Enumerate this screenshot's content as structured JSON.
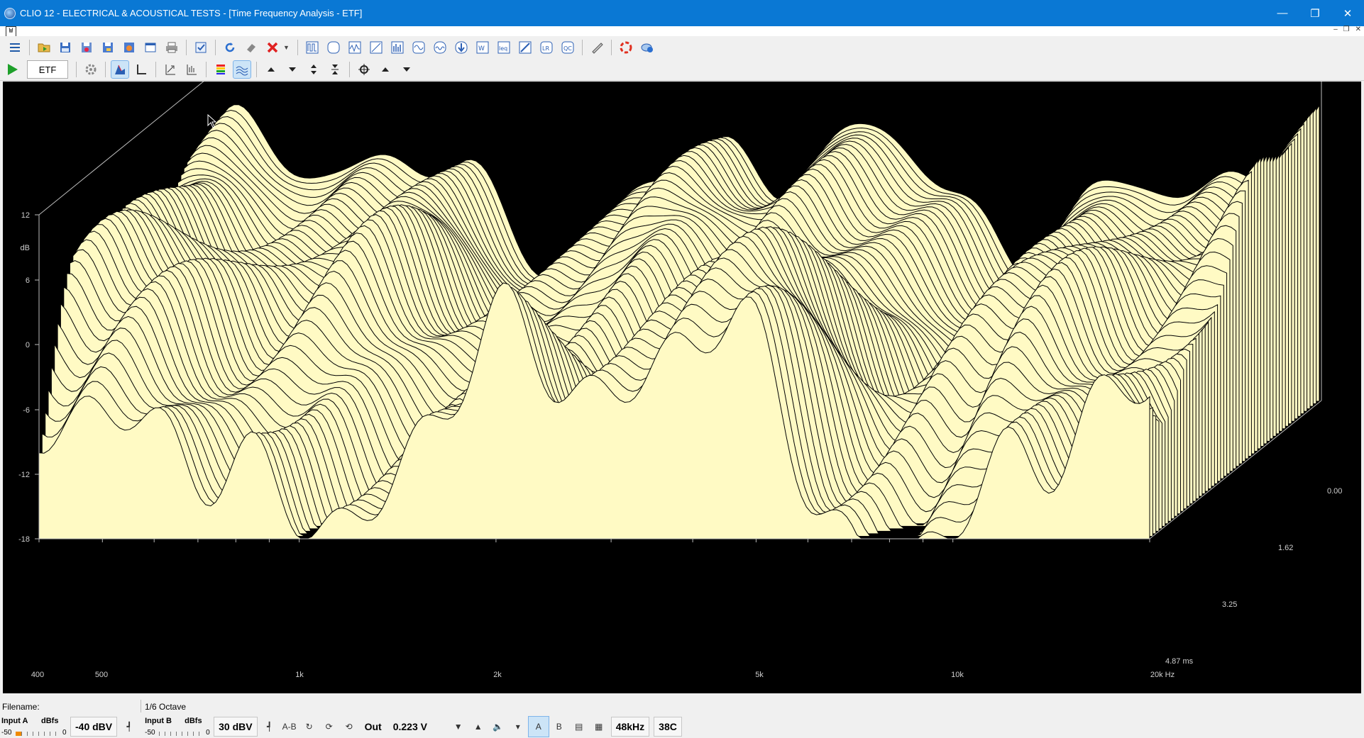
{
  "window": {
    "title": "CLIO 12 - ELECTRICAL & ACOUSTICAL TESTS - [Time Frequency Analysis - ETF]"
  },
  "mdi": {
    "icon_text": "W"
  },
  "toolbar1": {
    "icons": [
      "menu-icon",
      "open-folder-icon",
      "save-icon",
      "save-all-icon",
      "export-icon",
      "image-export-icon",
      "notes-icon",
      "print-icon",
      "checklist-icon",
      "rotate-icon",
      "eraser-icon",
      "delete-icon",
      "mls-icon",
      "sinusoidal-icon",
      "fft-icon",
      "multimeter-icon",
      "spectrum-icon",
      "sweep-icon",
      "wow-icon",
      "impedance-icon",
      "waterfall-icon",
      "leq-icon",
      "thiele-small-icon",
      "linearity-icon",
      "qc-icon",
      "ruler-icon",
      "help-icon",
      "cloud-help-icon"
    ]
  },
  "toolbar2": {
    "analysis_label": "ETF"
  },
  "plot": {
    "y_ticks": [
      "12",
      "6",
      "0",
      "-6",
      "-12",
      "-18"
    ],
    "y_unit": "dB",
    "x_ticks": [
      "400",
      "500",
      "1k",
      "2k",
      "5k",
      "10k",
      "20k Hz"
    ],
    "z_ticks": [
      "0.00",
      "1.62",
      "3.25",
      "4.87 ms"
    ]
  },
  "chart_data": {
    "type": "waterfall",
    "xlabel": "Hz",
    "ylabel": "dB",
    "zlabel": "ms",
    "x_scale": "log",
    "xlim": [
      400,
      20000
    ],
    "ylim": [
      -18,
      12
    ],
    "zlim": [
      0.0,
      4.87
    ],
    "fill_color": "#fffac4",
    "line_color": "#000000",
    "background": "#000000"
  },
  "status": {
    "filename_label": "Filename:",
    "octave": "1/6 Octave",
    "input_a": {
      "label": "Input A",
      "unit": "dBfs",
      "min": "-50",
      "max": "0",
      "value": "-40 dBV"
    },
    "input_b": {
      "label": "Input B",
      "unit": "dBfs",
      "min": "-50",
      "max": "0",
      "value": "30 dBV"
    },
    "ab_label": "A-B",
    "out_label": "Out",
    "out_value": "0.223 V",
    "a_label": "A",
    "b_label": "B",
    "sample_rate": "48kHz",
    "temperature": "38C"
  }
}
